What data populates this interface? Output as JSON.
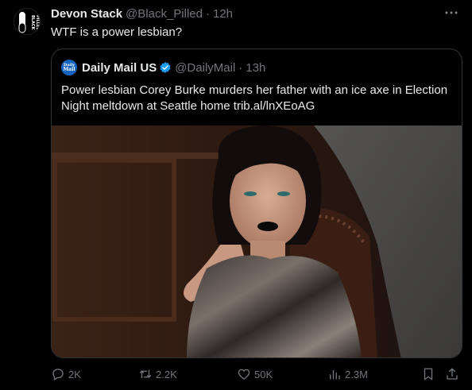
{
  "tweet": {
    "author_name": "Devon Stack",
    "author_handle": "@Black_Pilled",
    "separator": "·",
    "time": "12h",
    "text": "WTF is a power lesbian?",
    "avatar_logo_text": "BLACK PILLED",
    "more_icon": "more-dots-icon"
  },
  "quote": {
    "author_name": "Daily Mail US",
    "author_handle": "@DailyMail",
    "separator": "·",
    "time": "13h",
    "avatar_logo_text": "Daily Mail",
    "verified_icon": "verified-badge-icon",
    "text": "Power lesbian Corey Burke murders her father with an ice axe in Election Night meltdown at Seattle home trib.al/lnXEoAG",
    "image_icon": "article-photo"
  },
  "actions": {
    "reply_count": "2K",
    "retweet_count": "2.2K",
    "like_count": "50K",
    "views_count": "2.3M"
  },
  "colors": {
    "background": "#000000",
    "text_primary": "#e7e9ea",
    "text_secondary": "#71767b",
    "border": "#2f3336",
    "verified": "#1d9bf0"
  }
}
